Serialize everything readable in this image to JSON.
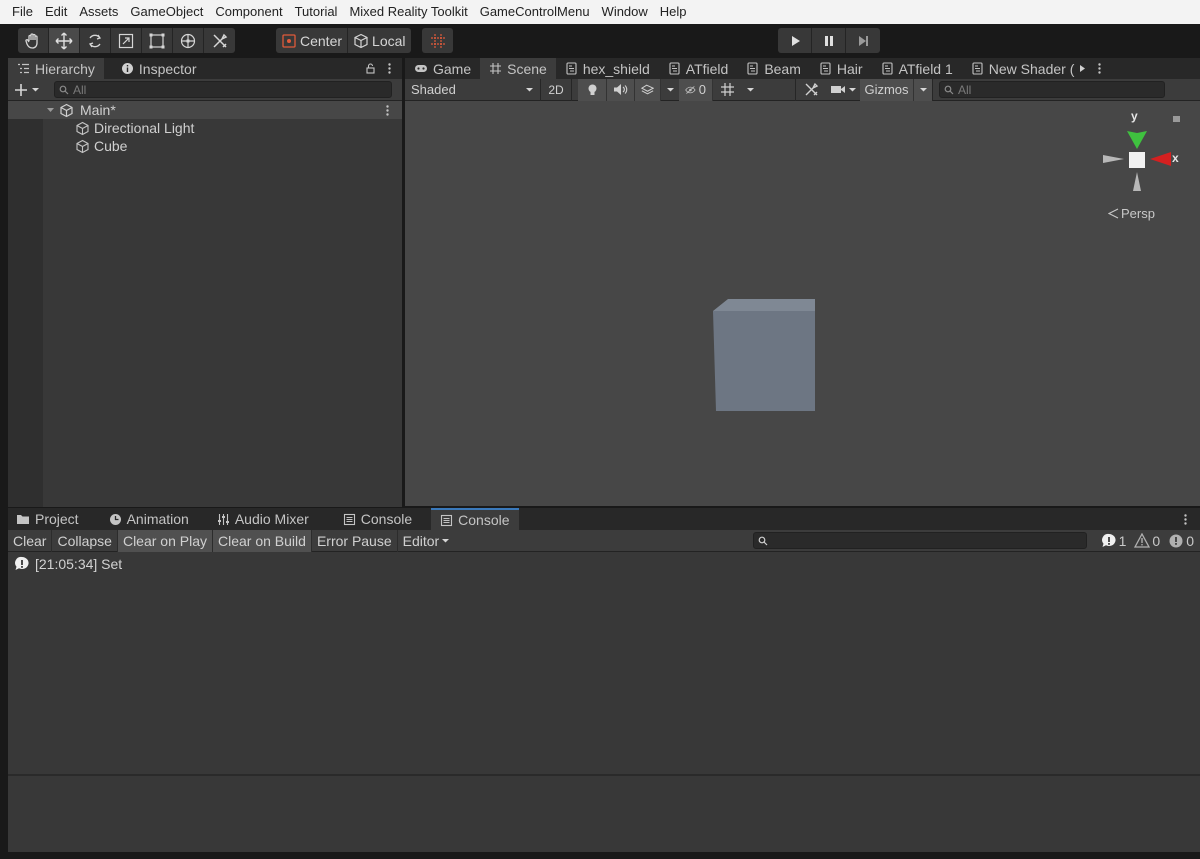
{
  "menu": [
    "File",
    "Edit",
    "Assets",
    "GameObject",
    "Component",
    "Tutorial",
    "Mixed Reality Toolkit",
    "GameControlMenu",
    "Window",
    "Help"
  ],
  "toolbar": {
    "pivot_center": "Center",
    "pivot_local": "Local"
  },
  "hierarchy": {
    "tab_hierarchy": "Hierarchy",
    "tab_inspector": "Inspector",
    "search_placeholder": "All",
    "scene_name": "Main*",
    "items": [
      "Directional Light",
      "Cube"
    ]
  },
  "scene": {
    "tabs": [
      {
        "label": "Game",
        "icon": "gamepad-icon"
      },
      {
        "label": "Scene",
        "icon": "grid-icon"
      },
      {
        "label": "hex_shield",
        "icon": "shader-graph-icon"
      },
      {
        "label": "ATfield",
        "icon": "shader-graph-icon"
      },
      {
        "label": "Beam",
        "icon": "shader-graph-icon"
      },
      {
        "label": "Hair",
        "icon": "shader-graph-icon"
      },
      {
        "label": "ATfield 1",
        "icon": "shader-graph-icon"
      },
      {
        "label": "New Shader (",
        "icon": "shader-graph-icon"
      }
    ],
    "shading_mode": "Shaded",
    "mode_2d": "2D",
    "hidden_count": "0",
    "gizmos": "Gizmos",
    "search_placeholder": "All",
    "projection": "Persp",
    "axis_x": "x",
    "axis_y": "y"
  },
  "bottom": {
    "tabs": [
      {
        "label": "Project",
        "icon": "folder-icon"
      },
      {
        "label": "Animation",
        "icon": "clock-icon"
      },
      {
        "label": "Audio Mixer",
        "icon": "mixer-icon"
      },
      {
        "label": "Console",
        "icon": "console-icon"
      },
      {
        "label": "Console",
        "icon": "console-icon"
      }
    ],
    "buttons": [
      "Clear",
      "Collapse",
      "Clear on Play",
      "Clear on Build",
      "Error Pause",
      "Editor"
    ],
    "counts": {
      "info": "1",
      "warnings": "0",
      "errors": "0"
    },
    "log": [
      {
        "text": "[21:05:34] Set"
      }
    ]
  },
  "colors": {
    "accent_tab": "#3a79bb",
    "axis_x": "#d42020",
    "axis_y": "#3fc13f",
    "cube": "#6d7683"
  }
}
